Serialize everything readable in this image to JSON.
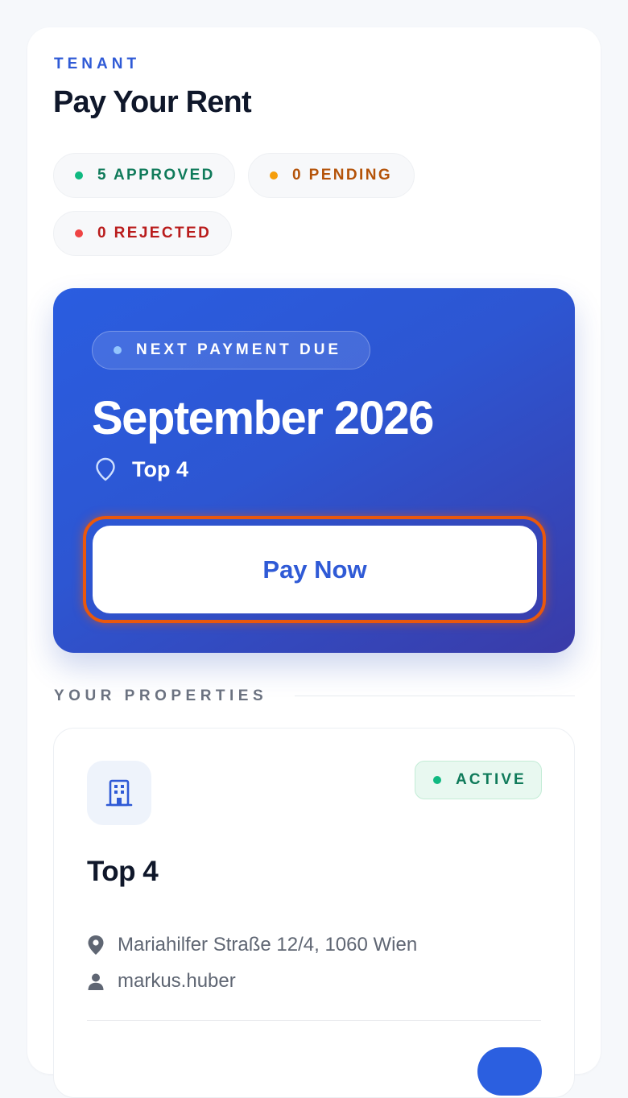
{
  "header": {
    "eyebrow": "TENANT",
    "title": "Pay Your Rent"
  },
  "status_pills": {
    "approved": "5 APPROVED",
    "pending": "0 PENDING",
    "rejected": "0 REJECTED"
  },
  "next_payment": {
    "chip_label": "NEXT PAYMENT DUE",
    "month": "September 2026",
    "unit": "Top 4",
    "pay_button_label": "Pay Now"
  },
  "properties_section": {
    "label": "YOUR PROPERTIES",
    "items": [
      {
        "status": "ACTIVE",
        "name": "Top 4",
        "address": "Mariahilfer Straße 12/4, 1060 Wien",
        "user": "markus.huber"
      }
    ]
  },
  "colors": {
    "accent": "#2f5ad6",
    "approved": "#10b981",
    "pending": "#f59e0b",
    "rejected": "#ef4444",
    "focus_ring": "#ea580c"
  },
  "icons": {
    "location_outline": "map-pin-outline-icon",
    "building": "building-icon",
    "location_filled": "map-pin-icon",
    "user": "user-icon"
  }
}
